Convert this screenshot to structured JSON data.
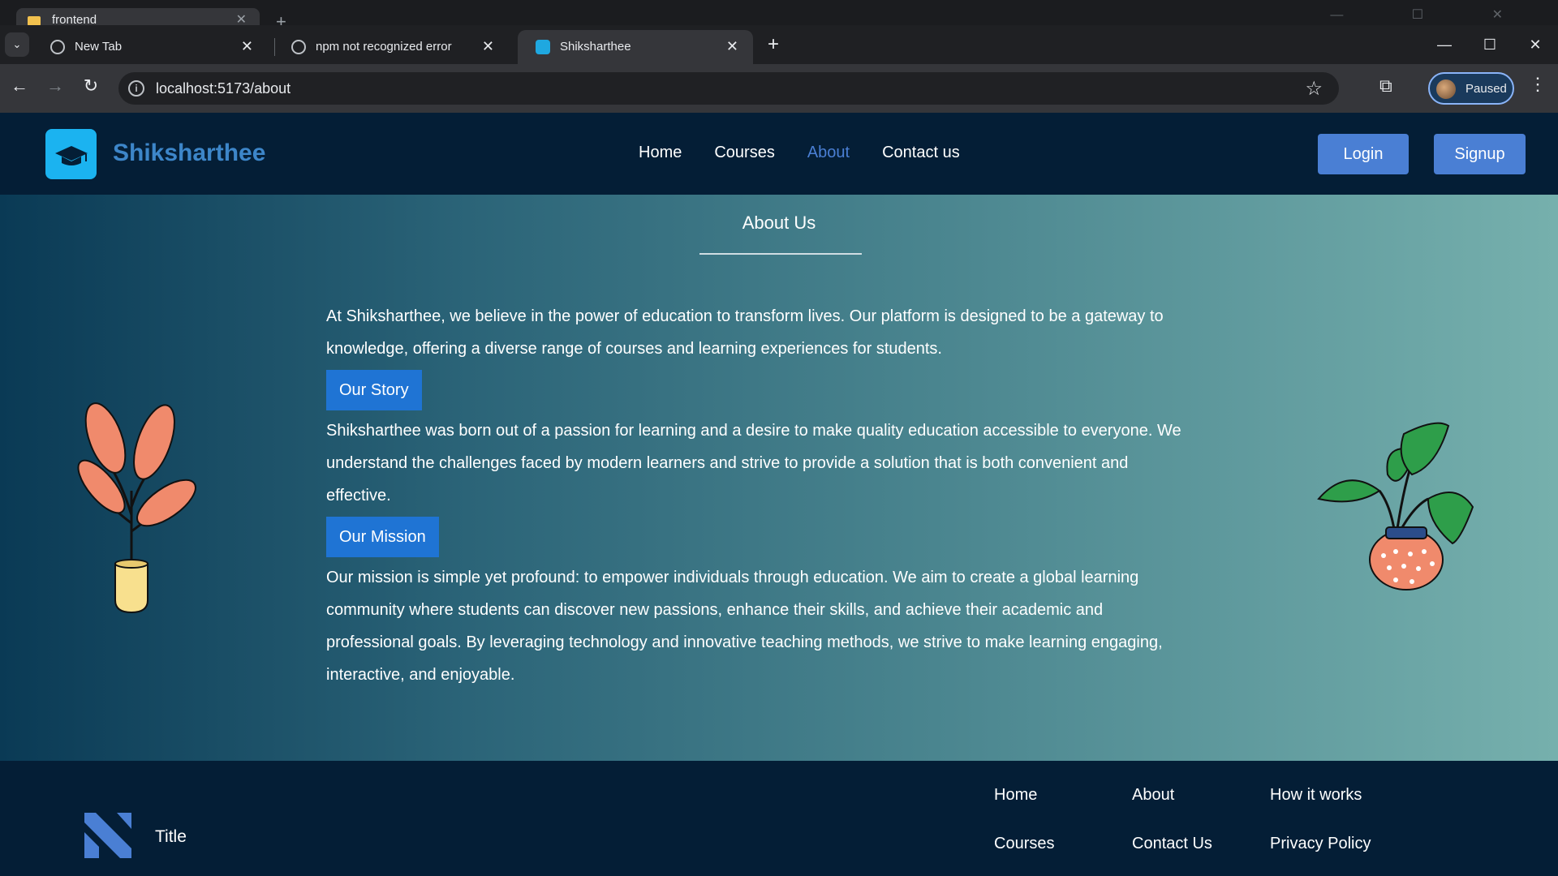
{
  "background_window": {
    "tab_title": "frontend"
  },
  "tabs": [
    {
      "title": "New Tab"
    },
    {
      "title": "npm not recognized error"
    },
    {
      "title": "Shiksharthee"
    }
  ],
  "address_bar": {
    "url": "localhost:5173/about"
  },
  "profile": {
    "status": "Paused"
  },
  "site": {
    "brand": "Shiksharthee",
    "nav": [
      "Home",
      "Courses",
      "About",
      "Contact us"
    ],
    "active_nav": "About",
    "login_label": "Login",
    "signup_label": "Signup",
    "accent_color": "#4a7fd4"
  },
  "about": {
    "title": "About Us",
    "intro": "At Shiksharthee, we believe in the power of education to transform lives. Our platform is designed to be a gateway to knowledge, offering a diverse range of courses and learning experiences for students.",
    "story_label": "Our Story",
    "story_text": "Shiksharthee was born out of a passion for learning and a desire to make quality education accessible to everyone. We understand the challenges faced by modern learners and strive to provide a solution that is both convenient and effective.",
    "mission_label": "Our Mission",
    "mission_text": "Our mission is simple yet profound: to empower individuals through education. We aim to create a global learning community where students can discover new passions, enhance their skills, and achieve their academic and professional goals. By leveraging technology and innovative teaching methods, we strive to make learning engaging, interactive, and enjoyable."
  },
  "footer": {
    "title": "Title",
    "links": [
      "Home",
      "About",
      "How it works",
      "Courses",
      "Contact Us",
      "Privacy Policy"
    ]
  }
}
